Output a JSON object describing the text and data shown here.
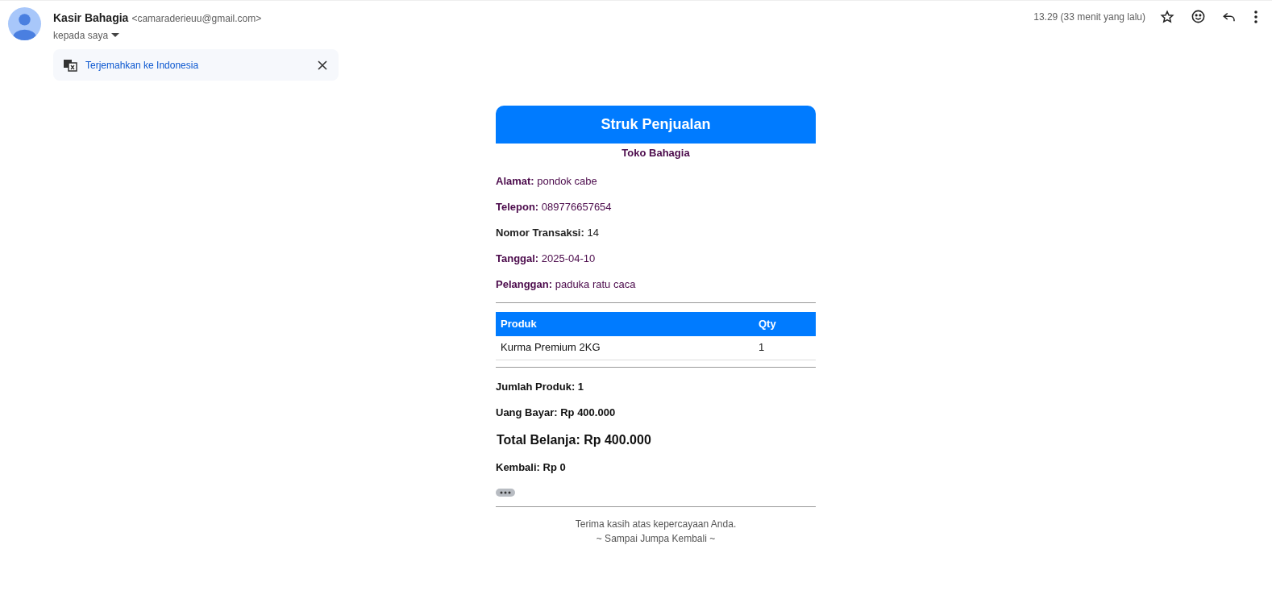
{
  "email": {
    "sender_name": "Kasir Bahagia",
    "sender_address": "<camaraderieuu@gmail.com>",
    "recipient": "kepada saya",
    "time": "13.29 (33 menit yang lalu)"
  },
  "translate_bar": {
    "link": "Terjemahkan ke Indonesia"
  },
  "receipt": {
    "title": "Struk Penjualan",
    "store": "Toko Bahagia",
    "info": [
      {
        "text": "**Alamat:** pondok cabe",
        "color": "#4b0a4b"
      },
      {
        "text": "**Telepon:** 089776657654",
        "color": "#4b0a4b"
      },
      {
        "text": "**Nomor Transaksi:** 14",
        "color": "#222222"
      },
      {
        "text": "**Tanggal:** 2025-04-10",
        "color": "#4b0a4b"
      },
      {
        "text": "**Pelanggan:** paduka ratu caca",
        "color": "#4b0a4b"
      }
    ],
    "table": {
      "columns": [
        "Produk",
        "Qty"
      ],
      "rows": [
        [
          "Kurma Premium 2KG",
          "1"
        ]
      ]
    },
    "summary": [
      {
        "kind": "line",
        "text": "Jumlah Produk: 1"
      },
      {
        "kind": "line",
        "text": "Uang Bayar: Rp 400.000"
      },
      {
        "kind": "total",
        "text": "Total Belanja: Rp 400.000"
      },
      {
        "kind": "line",
        "text": "Kembali: Rp 0"
      }
    ],
    "footer": [
      "Terima kasih atas kepercayaan Anda.",
      "~ Sampai Jumpa Kembali ~"
    ]
  }
}
